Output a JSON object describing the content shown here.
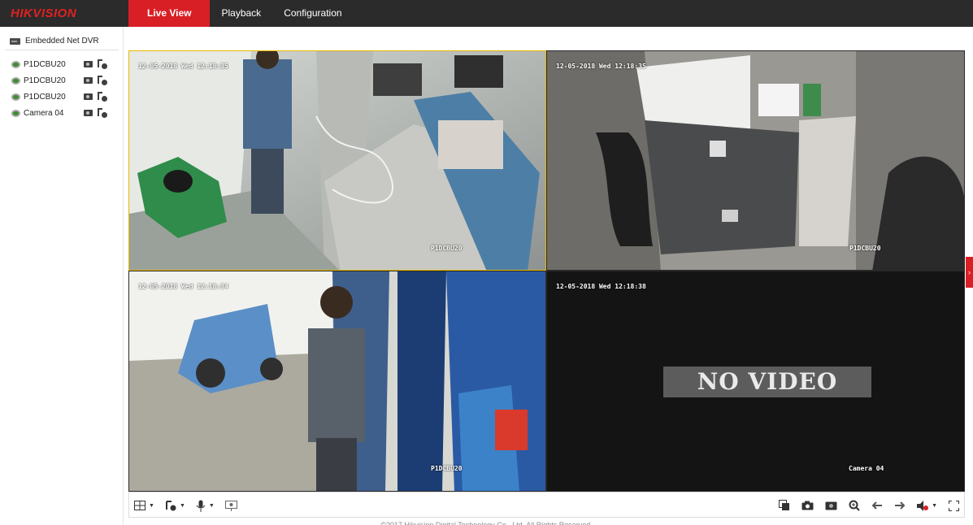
{
  "brand": {
    "logo_text": "HIKVISION",
    "logo_color": "#e02020",
    "accent": "#d91f26"
  },
  "nav": {
    "items": [
      {
        "label": "Live View",
        "active": true
      },
      {
        "label": "Playback",
        "active": false
      },
      {
        "label": "Configuration",
        "active": false
      }
    ]
  },
  "sidebar": {
    "device_label": "Embedded Net DVR",
    "cameras": [
      {
        "label": "P1DCBU20",
        "icon": "camera-online-icon"
      },
      {
        "label": "P1DCBU20",
        "icon": "camera-online-icon"
      },
      {
        "label": "P1DCBU20",
        "icon": "camera-online-icon"
      },
      {
        "label": "Camera 04",
        "icon": "camera-online-icon"
      }
    ]
  },
  "video": {
    "tiles": [
      {
        "timestamp": "12-05-2018 Wed 12:18:35",
        "channel": "P1DCBU20",
        "selected": true
      },
      {
        "timestamp": "12-05-2018 Wed 12:18:35",
        "channel": "P1DCBU20",
        "selected": false
      },
      {
        "timestamp": "12-05-2018 Wed 12:18:34",
        "channel": "P1DCBU20",
        "selected": false
      },
      {
        "timestamp": "12-05-2018 Wed 12:18:38",
        "channel": "Camera 04",
        "selected": false,
        "no_video": "NO VIDEO"
      }
    ]
  },
  "toolbar": {
    "left": [
      "window-layout-icon",
      "stream-type-icon",
      "microphone-icon",
      "fisheye-icon"
    ],
    "right": [
      "stop-all-icon",
      "capture-icon",
      "record-icon",
      "digital-zoom-icon",
      "previous-page-icon",
      "next-page-icon",
      "volume-icon",
      "fullscreen-icon"
    ]
  },
  "footer": {
    "text": "©2017 Hikvision Digital Technology Co., Ltd. All Rights Reserved."
  }
}
